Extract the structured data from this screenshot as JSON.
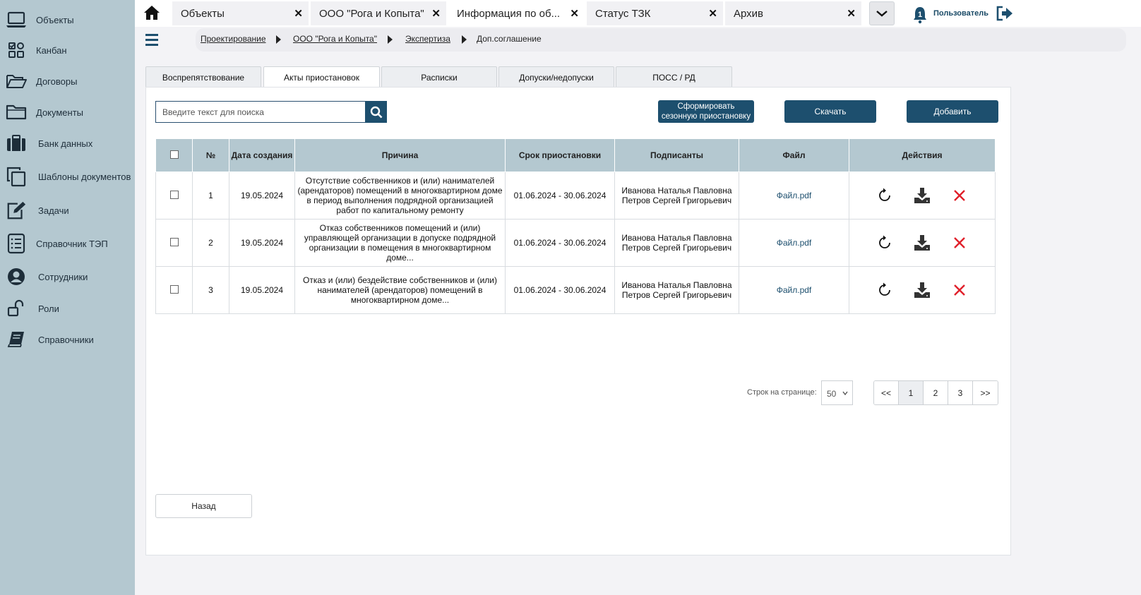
{
  "sidebar": {
    "items": [
      {
        "label": "Объекты",
        "icon": "laptop-icon"
      },
      {
        "label": "Канбан",
        "icon": "kanban-icon"
      },
      {
        "label": "Договоры",
        "icon": "folder-open-icon"
      },
      {
        "label": "Документы",
        "icon": "folder-icon"
      },
      {
        "label": "Банк данных",
        "icon": "briefcase-icon"
      },
      {
        "label": "Шаблоны документов",
        "icon": "copy-icon"
      },
      {
        "label": "Задачи",
        "icon": "edit-icon"
      },
      {
        "label": "Справочник ТЭП",
        "icon": "list-icon"
      },
      {
        "label": "Сотрудники",
        "icon": "user-circle-icon"
      },
      {
        "label": "Роли",
        "icon": "lock-open-icon"
      },
      {
        "label": "Справочники",
        "icon": "book-icon"
      }
    ]
  },
  "topbar": {
    "tabs": [
      {
        "label": "Объекты"
      },
      {
        "label": "ООО \"Рога и Копыта\""
      },
      {
        "label": "Информация по об..."
      },
      {
        "label": "Статус ТЗК"
      },
      {
        "label": "Архив"
      }
    ],
    "close_glyph": "✕",
    "notification_count": "1",
    "user_label": "Пользователь"
  },
  "breadcrumb": {
    "items": [
      "Проектирование",
      "ООО \"Рога и Копыта\"",
      "Экспертиза",
      "Доп.соглашение"
    ]
  },
  "content_tabs": [
    "Воспрепятствование",
    "Акты приостановок",
    "Расписки",
    "Допуски/недопуски",
    "ПОСС / РД"
  ],
  "toolbar": {
    "search_placeholder": "Введите текст для поиска",
    "generate_label_line1": "Сформировать",
    "generate_label_line2": "сезонную приостановку",
    "download_label": "Скачать",
    "add_label": "Добавить"
  },
  "table": {
    "headers": [
      "№",
      "Дата создания",
      "Причина",
      "Срок приостановки",
      "Подписанты",
      "Файл",
      "Действия"
    ],
    "rows": [
      {
        "num": "1",
        "date": "19.05.2024",
        "reason": "Отсутствие собственников и (или) нанимателей (арендаторов) помещений в многоквартирном доме в период выполнения подрядной организацией работ по капитальному ремонту",
        "period": "01.06.2024 - 30.06.2024",
        "signer1": "Иванова Наталья Павловна",
        "signer2": "Петров Сергей Григорьевич",
        "file": "Файл.pdf"
      },
      {
        "num": "2",
        "date": "19.05.2024",
        "reason": "Отказ собственников помещений и (или) управляющей организации в допуске подрядной организации в помещения в многоквартирном доме...",
        "period": "01.06.2024 - 30.06.2024",
        "signer1": "Иванова Наталья Павловна",
        "signer2": "Петров Сергей Григорьевич",
        "file": "Файл.pdf"
      },
      {
        "num": "3",
        "date": "19.05.2024",
        "reason": "Отказ и (или) бездействие собственников и (или) нанимателей (арендаторов) помещений в многоквартирном доме...",
        "period": "01.06.2024 - 30.06.2024",
        "signer1": "Иванова Наталья Павловна",
        "signer2": "Петров Сергей Григорьевич",
        "file": "Файл.pdf"
      }
    ]
  },
  "pagination": {
    "rows_label": "Строк на странице:",
    "rows_value": "50",
    "first": "<<",
    "pages": [
      "1",
      "2",
      "3"
    ],
    "last": ">>",
    "current": "1"
  },
  "footer": {
    "back_label": "Назад"
  },
  "colors": {
    "sidebar_bg": "#b4c8d0",
    "accent": "#1d4f6e",
    "delete_red": "#e0202a"
  }
}
